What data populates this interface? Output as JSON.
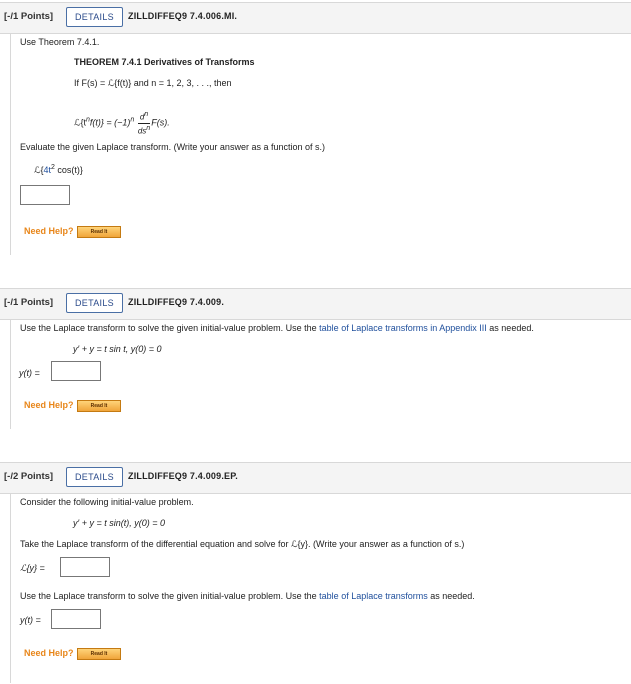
{
  "q1": {
    "points": "[-/1 Points]",
    "details_label": "DETAILS",
    "code": "ZILLDIFFEQ9 7.4.006.MI.",
    "instruction": "Use Theorem 7.4.1.",
    "theorem_title": "THEOREM 7.4.1  Derivatives of Transforms",
    "theorem_line": "If F(s) = ℒ{f(t)} and n = 1, 2, 3, . . ., then",
    "formula_lhs": "ℒ{t",
    "formula_n1": "n",
    "formula_mid": "f(t)} = (−1)",
    "formula_n2": "n",
    "formula_frac_num": "d",
    "formula_frac_num_exp": "n",
    "formula_frac_den": "ds",
    "formula_frac_den_exp": "n",
    "formula_rhs": "F(s).",
    "prompt": "Evaluate the given Laplace transform. (Write your answer as a function of s.)",
    "expr_prefix": "ℒ{",
    "expr_coef": "4t",
    "expr_exp": "2",
    "expr_suffix": " cos(t)}",
    "need_help": "Need Help?",
    "read_it": "Read It"
  },
  "q2": {
    "points": "[-/1 Points]",
    "details_label": "DETAILS",
    "code": "ZILLDIFFEQ9 7.4.009.",
    "instruction_pre": "Use the Laplace transform to solve the given initial-value problem. Use the",
    "instruction_link": "table of Laplace transforms in Appendix III",
    "instruction_post": "as needed.",
    "equation": "y′ + y = t sin t,    y(0) = 0",
    "answer_label": "y(t) =",
    "need_help": "Need Help?",
    "read_it": "Read It"
  },
  "q3": {
    "points": "[-/2 Points]",
    "details_label": "DETAILS",
    "code": "ZILLDIFFEQ9 7.4.009.EP.",
    "intro": "Consider the following initial-value problem.",
    "equation": "y′ + y = t sin(t),    y(0) = 0",
    "part1_prompt": "Take the Laplace transform of the differential equation and solve for ℒ{y}. (Write your answer as a function of s.)",
    "part1_label": "ℒ{y} =",
    "part2_pre": "Use the Laplace transform to solve the given initial-value problem. Use the",
    "part2_link": "table of Laplace transforms",
    "part2_post": "as needed.",
    "part2_label": "y(t) =",
    "need_help": "Need Help?",
    "read_it": "Read It"
  }
}
